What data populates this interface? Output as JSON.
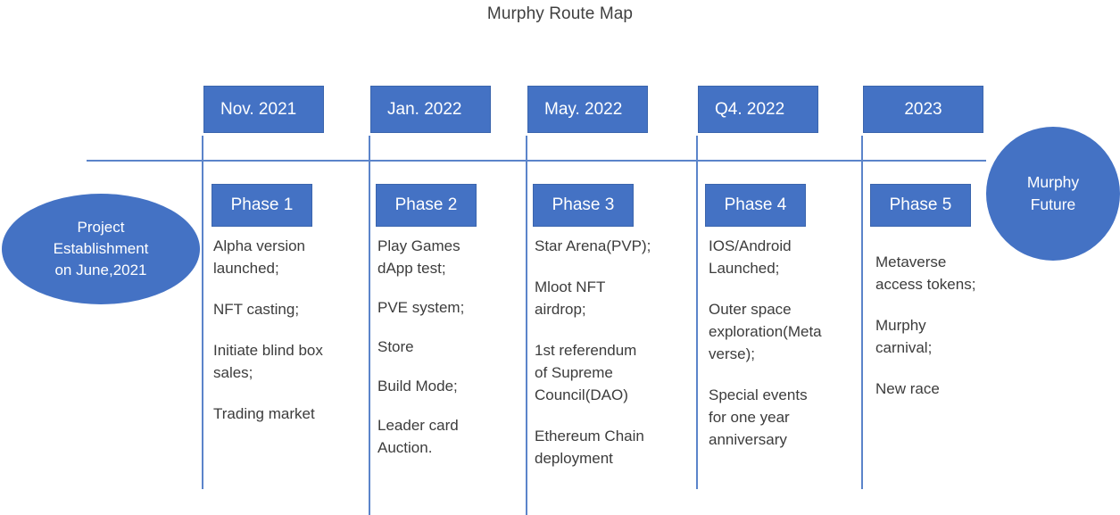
{
  "title": "Murphy Route Map",
  "colors": {
    "accent_blue": "#4472C4",
    "line_blue": "#5B84CA",
    "text_gray": "#3C3C3C",
    "title_gray": "#404040",
    "box_text": "#FFFFFF"
  },
  "start_node": {
    "label": "Project\nEstablishment\non June,2021",
    "shape": "ellipse"
  },
  "end_node": {
    "label": "Murphy\nFuture",
    "shape": "circle"
  },
  "milestones": [
    {
      "date": "Nov. 2021",
      "phase": "Phase 1",
      "items": [
        "Alpha version\nlaunched;",
        "NFT casting;",
        "Initiate blind box\nsales;",
        "Trading market"
      ]
    },
    {
      "date": "Jan. 2022",
      "phase": "Phase 2",
      "items": [
        "Play Games\ndApp test;",
        "PVE system;",
        "Store",
        "Build Mode;",
        "Leader card\nAuction."
      ]
    },
    {
      "date": "May. 2022",
      "phase": "Phase 3",
      "items": [
        "Star Arena(PVP);",
        "Mloot NFT\nairdrop;",
        "1st referendum\nof Supreme\nCouncil(DAO)",
        "Ethereum Chain\ndeployment"
      ]
    },
    {
      "date": "Q4. 2022",
      "phase": "Phase 4",
      "items": [
        "IOS/Android\nLaunched;",
        "Outer space\nexploration(Meta\nverse);",
        "Special events\nfor one year\nanniversary"
      ]
    },
    {
      "date": "2023",
      "phase": "Phase 5",
      "items": [
        "Metaverse\naccess tokens;",
        "Murphy\ncarnival;",
        "New race"
      ]
    }
  ]
}
